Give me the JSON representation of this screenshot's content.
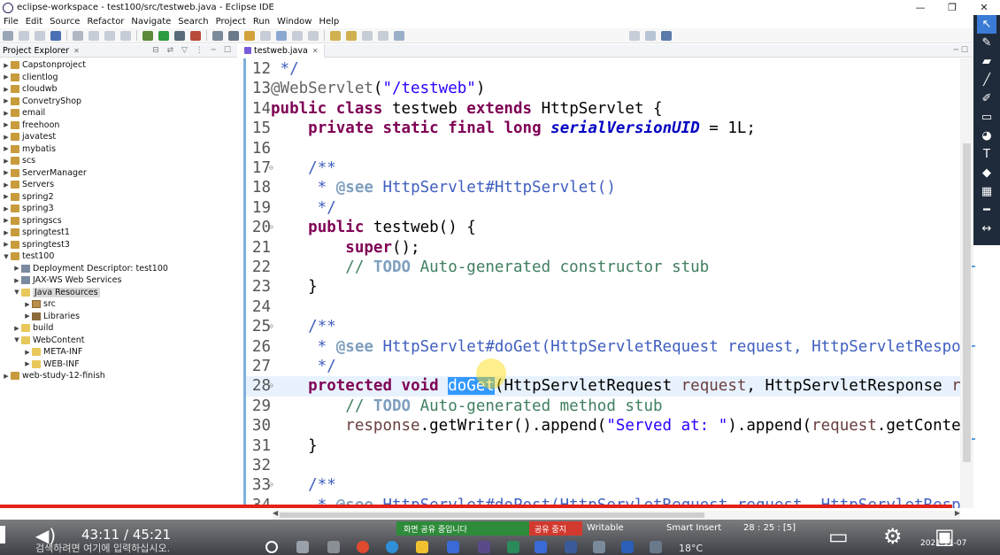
{
  "window": {
    "title": "eclipse-workspace - test100/src/testweb.java - Eclipse IDE",
    "buttons": [
      "—",
      "❐",
      "✕"
    ]
  },
  "menu": [
    "File",
    "Edit",
    "Source",
    "Refactor",
    "Navigate",
    "Search",
    "Project",
    "Run",
    "Window",
    "Help"
  ],
  "explorer": {
    "title": "Project Explorer",
    "items": [
      {
        "label": "Capstonproject",
        "depth": 0,
        "expanded": false,
        "icon": "project"
      },
      {
        "label": "clientlog",
        "depth": 0,
        "expanded": false,
        "icon": "project"
      },
      {
        "label": "cloudwb",
        "depth": 0,
        "expanded": false,
        "icon": "project"
      },
      {
        "label": "ConvetryShop",
        "depth": 0,
        "expanded": false,
        "icon": "project"
      },
      {
        "label": "email",
        "depth": 0,
        "expanded": false,
        "icon": "project"
      },
      {
        "label": "freehoon",
        "depth": 0,
        "expanded": false,
        "icon": "project"
      },
      {
        "label": "javatest",
        "depth": 0,
        "expanded": false,
        "icon": "project"
      },
      {
        "label": "mybatis",
        "depth": 0,
        "expanded": false,
        "icon": "project"
      },
      {
        "label": "scs",
        "depth": 0,
        "expanded": false,
        "icon": "project"
      },
      {
        "label": "ServerManager",
        "depth": 0,
        "expanded": false,
        "icon": "project"
      },
      {
        "label": "Servers",
        "depth": 0,
        "expanded": false,
        "icon": "project"
      },
      {
        "label": "spring2",
        "depth": 0,
        "expanded": false,
        "icon": "project"
      },
      {
        "label": "spring3",
        "depth": 0,
        "expanded": false,
        "icon": "project"
      },
      {
        "label": "springscs",
        "depth": 0,
        "expanded": false,
        "icon": "project"
      },
      {
        "label": "springtest1",
        "depth": 0,
        "expanded": false,
        "icon": "project"
      },
      {
        "label": "springtest3",
        "depth": 0,
        "expanded": false,
        "icon": "project"
      },
      {
        "label": "test100",
        "depth": 0,
        "expanded": true,
        "icon": "project"
      },
      {
        "label": "Deployment Descriptor: test100",
        "depth": 1,
        "expanded": false,
        "icon": "dd"
      },
      {
        "label": "JAX-WS Web Services",
        "depth": 1,
        "expanded": false,
        "icon": "dd"
      },
      {
        "label": "Java Resources",
        "depth": 1,
        "expanded": true,
        "icon": "folder",
        "selected": true
      },
      {
        "label": "src",
        "depth": 2,
        "expanded": false,
        "icon": "pkg"
      },
      {
        "label": "Libraries",
        "depth": 2,
        "expanded": false,
        "icon": "lib"
      },
      {
        "label": "build",
        "depth": 1,
        "expanded": false,
        "icon": "folder"
      },
      {
        "label": "WebContent",
        "depth": 1,
        "expanded": true,
        "icon": "folder"
      },
      {
        "label": "META-INF",
        "depth": 2,
        "expanded": false,
        "icon": "folder"
      },
      {
        "label": "WEB-INF",
        "depth": 2,
        "expanded": false,
        "icon": "folder"
      },
      {
        "label": "web-study-12-finish",
        "depth": 0,
        "expanded": false,
        "icon": "project"
      }
    ]
  },
  "editor": {
    "tab": "testweb.java",
    "current_line": 28,
    "lines": [
      {
        "n": "12",
        "fold": "",
        "tokens": [
          {
            "t": " */",
            "c": "jd"
          }
        ]
      },
      {
        "n": "13",
        "fold": "",
        "tokens": [
          {
            "t": "@WebServlet",
            "c": "ann"
          },
          {
            "t": "("
          },
          {
            "t": "\"/testweb\"",
            "c": "str"
          },
          {
            "t": ")"
          }
        ]
      },
      {
        "n": "14",
        "fold": "",
        "tokens": [
          {
            "t": "public",
            "c": "kw"
          },
          {
            "t": " "
          },
          {
            "t": "class",
            "c": "kw"
          },
          {
            "t": " testweb "
          },
          {
            "t": "extends",
            "c": "kw"
          },
          {
            "t": " HttpServlet {"
          }
        ]
      },
      {
        "n": "15",
        "fold": "",
        "tokens": [
          {
            "t": "    "
          },
          {
            "t": "private",
            "c": "kw"
          },
          {
            "t": " "
          },
          {
            "t": "static",
            "c": "kw"
          },
          {
            "t": " "
          },
          {
            "t": "final",
            "c": "kw"
          },
          {
            "t": " "
          },
          {
            "t": "long",
            "c": "kw"
          },
          {
            "t": " "
          },
          {
            "t": "serialVersionUID",
            "c": "fld"
          },
          {
            "t": " = 1L;"
          }
        ]
      },
      {
        "n": "16",
        "fold": "",
        "tokens": []
      },
      {
        "n": "17",
        "fold": "⊖",
        "tokens": [
          {
            "t": "    "
          },
          {
            "t": "/**",
            "c": "jd"
          }
        ]
      },
      {
        "n": "18",
        "fold": "",
        "tokens": [
          {
            "t": "     * ",
            "c": "jd"
          },
          {
            "t": "@see",
            "c": "jdt"
          },
          {
            "t": " HttpServlet#HttpServlet()",
            "c": "jd"
          }
        ]
      },
      {
        "n": "19",
        "fold": "",
        "tokens": [
          {
            "t": "     */",
            "c": "jd"
          }
        ]
      },
      {
        "n": "20",
        "fold": "⊖",
        "tokens": [
          {
            "t": "    "
          },
          {
            "t": "public",
            "c": "kw"
          },
          {
            "t": " testweb() {"
          }
        ]
      },
      {
        "n": "21",
        "fold": "",
        "tokens": [
          {
            "t": "        "
          },
          {
            "t": "super",
            "c": "kw"
          },
          {
            "t": "();"
          }
        ]
      },
      {
        "n": "22",
        "fold": "",
        "tokens": [
          {
            "t": "        "
          },
          {
            "t": "// ",
            "c": "com"
          },
          {
            "t": "TODO",
            "c": "jdt"
          },
          {
            "t": " Auto-generated constructor stub",
            "c": "com"
          }
        ]
      },
      {
        "n": "23",
        "fold": "",
        "tokens": [
          {
            "t": "    }"
          }
        ]
      },
      {
        "n": "24",
        "fold": "",
        "tokens": []
      },
      {
        "n": "25",
        "fold": "⊖",
        "tokens": [
          {
            "t": "    "
          },
          {
            "t": "/**",
            "c": "jd"
          }
        ]
      },
      {
        "n": "26",
        "fold": "",
        "tokens": [
          {
            "t": "     * ",
            "c": "jd"
          },
          {
            "t": "@see",
            "c": "jdt"
          },
          {
            "t": " HttpServlet#doGet(HttpServletRequest request, HttpServletRespo",
            "c": "jd"
          }
        ]
      },
      {
        "n": "27",
        "fold": "",
        "tokens": [
          {
            "t": "     */",
            "c": "jd"
          }
        ]
      },
      {
        "n": "28",
        "fold": "⊖",
        "tokens": [
          {
            "t": "    "
          },
          {
            "t": "protected",
            "c": "kw"
          },
          {
            "t": " "
          },
          {
            "t": "void",
            "c": "kw"
          },
          {
            "t": " "
          },
          {
            "t": "doGet",
            "c": "sel"
          },
          {
            "t": "(HttpServletRequest "
          },
          {
            "t": "request",
            "c": "param"
          },
          {
            "t": ", HttpServletResponse "
          },
          {
            "t": "r",
            "c": "param"
          }
        ]
      },
      {
        "n": "29",
        "fold": "",
        "tokens": [
          {
            "t": "        "
          },
          {
            "t": "// ",
            "c": "com"
          },
          {
            "t": "TODO",
            "c": "jdt"
          },
          {
            "t": " Auto-generated method stub",
            "c": "com"
          }
        ]
      },
      {
        "n": "30",
        "fold": "",
        "tokens": [
          {
            "t": "        "
          },
          {
            "t": "response",
            "c": "param"
          },
          {
            "t": ".getWriter().append("
          },
          {
            "t": "\"Served at: \"",
            "c": "str"
          },
          {
            "t": ").append("
          },
          {
            "t": "request",
            "c": "param"
          },
          {
            "t": ".getConte"
          }
        ]
      },
      {
        "n": "31",
        "fold": "",
        "tokens": [
          {
            "t": "    }"
          }
        ]
      },
      {
        "n": "32",
        "fold": "",
        "tokens": []
      },
      {
        "n": "33",
        "fold": "⊖",
        "tokens": [
          {
            "t": "    "
          },
          {
            "t": "/**",
            "c": "jd"
          }
        ]
      },
      {
        "n": "34",
        "fold": "",
        "tokens": [
          {
            "t": "     * ",
            "c": "jd"
          },
          {
            "t": "@see",
            "c": "jdt"
          },
          {
            "t": " HttpServlet#doPost(HttpServletRequest request, HttpServletResp",
            "c": "jd"
          }
        ]
      }
    ]
  },
  "status": {
    "share_text": "화면 공유 중입니다",
    "stop_text": "공유 중지",
    "writable": "Writable",
    "insert_mode": "Smart Insert",
    "position": "28 : 25 : [5]"
  },
  "video": {
    "time": "43:11 / 45:21",
    "progress": 0.952
  },
  "taskbar": {
    "search_placeholder": "검색하려면 여기에 입력하십시오.",
    "weather": "18°C",
    "clock": "2021-11-07"
  },
  "colors": {
    "keyword": "#7f0055",
    "string": "#2a00ff",
    "comment": "#3f7f5f",
    "javadoc": "#3f5fbf",
    "selection": "#3399ff",
    "progress": "#e62117"
  }
}
